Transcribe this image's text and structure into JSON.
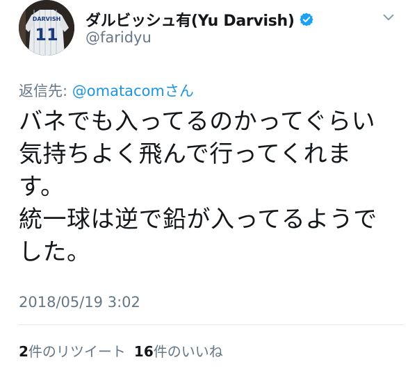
{
  "author": {
    "display_name": "ダルビッシュ有(Yu Darvish)",
    "handle": "@faridyu",
    "avatar_text": "DARVISH",
    "avatar_number": "11"
  },
  "reply": {
    "prefix": "返信先: ",
    "mention": "@omatacom",
    "suffix": "さん"
  },
  "body_lines": [
    "バネでも入ってるのかってぐらい",
    "気持ちよく飛んで行ってくれま",
    "す。",
    "統一球は逆で鉛が入ってるようで",
    "した。"
  ],
  "timestamp": "2018/05/19 3:02",
  "stats": {
    "retweets_count": "2",
    "retweets_label": "件のリツイート",
    "likes_count": "16",
    "likes_label": "件のいいね"
  },
  "colors": {
    "text": "#14171a",
    "secondary": "#657786",
    "link": "#1b95e0",
    "verified": "#1da1f2"
  },
  "icons": [
    "verified-badge-icon",
    "chevron-down-icon"
  ]
}
